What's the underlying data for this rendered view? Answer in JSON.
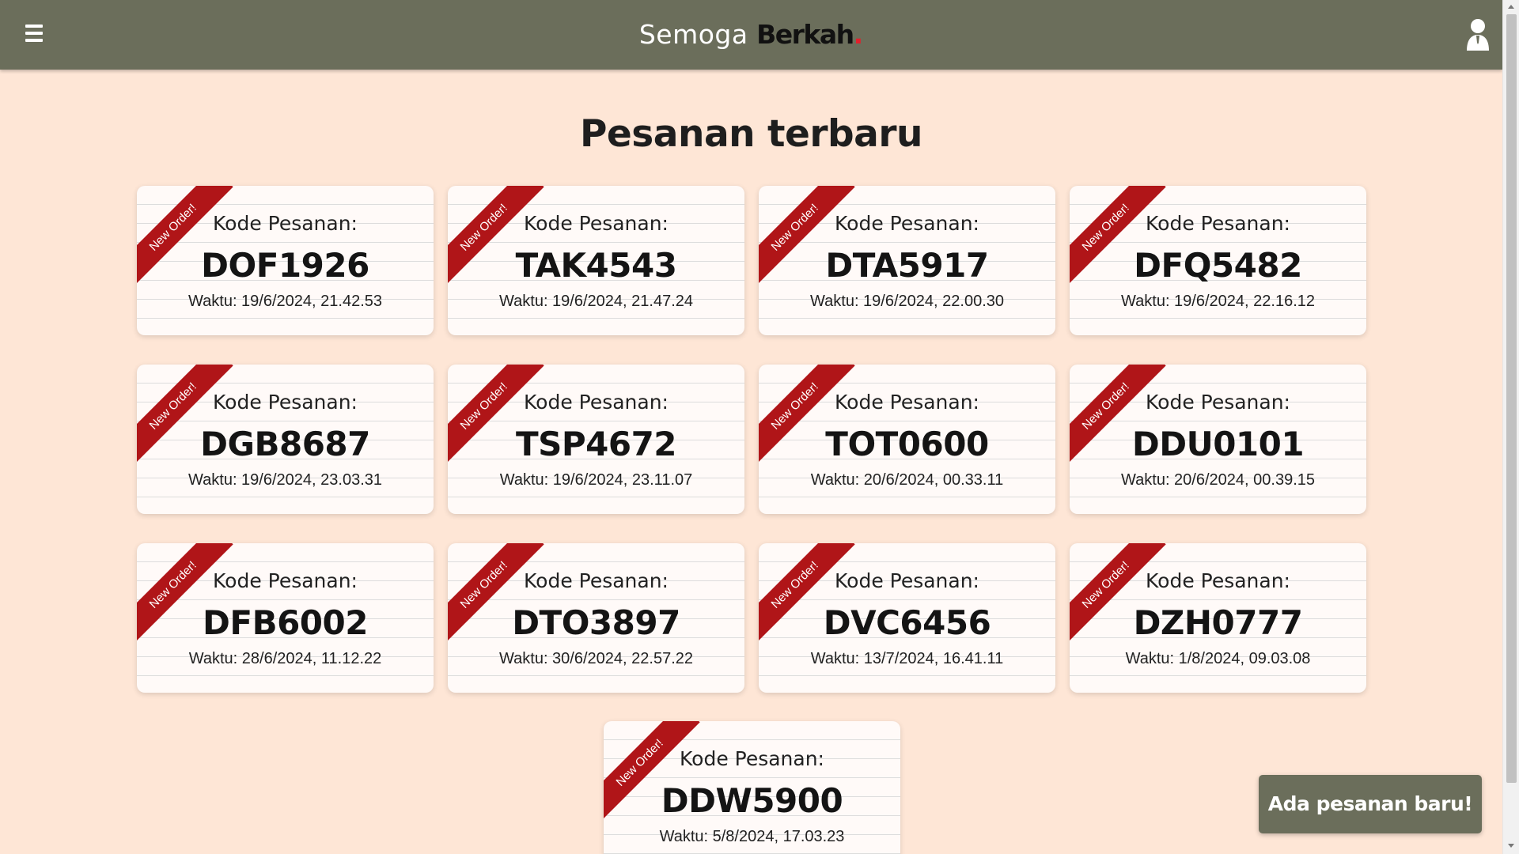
{
  "header": {
    "brand_light": "Semoga",
    "brand_bold": "Berkah",
    "brand_dot": ".",
    "menu_icon": "hamburger-menu-icon",
    "user_icon": "user-icon",
    "background": "#6b6e5b"
  },
  "page": {
    "title": "Pesanan terbaru",
    "background": "#fee6d6"
  },
  "ribbon_color": "#b01518",
  "orders": [
    {
      "ribbon": "New Order!",
      "label": "Kode Pesanan:",
      "code": "DOF1926",
      "time": "Waktu: 19/6/2024, 21.42.53"
    },
    {
      "ribbon": "New Order!",
      "label": "Kode Pesanan:",
      "code": "TAK4543",
      "time": "Waktu: 19/6/2024, 21.47.24"
    },
    {
      "ribbon": "New Order!",
      "label": "Kode Pesanan:",
      "code": "DTA5917",
      "time": "Waktu: 19/6/2024, 22.00.30"
    },
    {
      "ribbon": "New Order!",
      "label": "Kode Pesanan:",
      "code": "DFQ5482",
      "time": "Waktu: 19/6/2024, 22.16.12"
    },
    {
      "ribbon": "New Order!",
      "label": "Kode Pesanan:",
      "code": "DGB8687",
      "time": "Waktu: 19/6/2024, 23.03.31"
    },
    {
      "ribbon": "New Order!",
      "label": "Kode Pesanan:",
      "code": "TSP4672",
      "time": "Waktu: 19/6/2024, 23.11.07"
    },
    {
      "ribbon": "New Order!",
      "label": "Kode Pesanan:",
      "code": "TOT0600",
      "time": "Waktu: 20/6/2024, 00.33.11"
    },
    {
      "ribbon": "New Order!",
      "label": "Kode Pesanan:",
      "code": "DDU0101",
      "time": "Waktu: 20/6/2024, 00.39.15"
    },
    {
      "ribbon": "New Order!",
      "label": "Kode Pesanan:",
      "code": "DFB6002",
      "time": "Waktu: 28/6/2024, 11.12.22"
    },
    {
      "ribbon": "New Order!",
      "label": "Kode Pesanan:",
      "code": "DTO3897",
      "time": "Waktu: 30/6/2024, 22.57.22"
    },
    {
      "ribbon": "New Order!",
      "label": "Kode Pesanan:",
      "code": "DVC6456",
      "time": "Waktu: 13/7/2024, 16.41.11"
    },
    {
      "ribbon": "New Order!",
      "label": "Kode Pesanan:",
      "code": "DZH0777",
      "time": "Waktu: 1/8/2024, 09.03.08"
    },
    {
      "ribbon": "New Order!",
      "label": "Kode Pesanan:",
      "code": "DDW5900",
      "time": "Waktu: 5/8/2024, 17.03.23"
    }
  ],
  "toast": {
    "text": "Ada pesanan baru!"
  }
}
